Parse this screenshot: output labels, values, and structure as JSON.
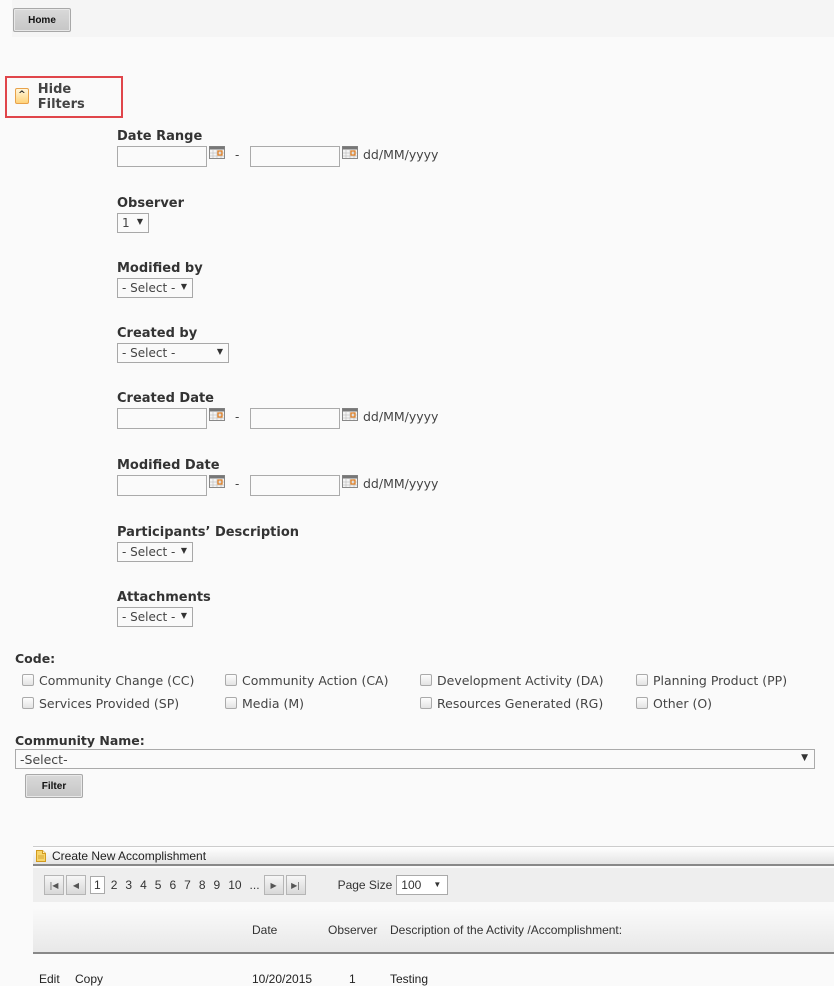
{
  "header": {
    "home_label": "Home"
  },
  "filters_toggle": {
    "label": "Hide Filters",
    "icon": "^"
  },
  "filters": {
    "date_range": {
      "label": "Date Range",
      "from": "",
      "to": "",
      "separator": "-",
      "format": "dd/MM/yyyy"
    },
    "observer": {
      "label": "Observer",
      "value": "1"
    },
    "modified_by": {
      "label": "Modified by",
      "value": "- Select -"
    },
    "created_by": {
      "label": "Created by",
      "value": "- Select -"
    },
    "created_date": {
      "label": "Created Date",
      "from": "",
      "to": "",
      "separator": "-",
      "format": "dd/MM/yyyy"
    },
    "modified_date": {
      "label": "Modified Date",
      "from": "",
      "to": "",
      "separator": "-",
      "format": "dd/MM/yyyy"
    },
    "participants_description": {
      "label": "Participants’ Description",
      "value": "- Select -"
    },
    "attachments": {
      "label": "Attachments",
      "value": "- Select -"
    }
  },
  "code": {
    "label": "Code:",
    "options": [
      {
        "label": "Community Change (CC)",
        "checked": false
      },
      {
        "label": "Community Action (CA)",
        "checked": false
      },
      {
        "label": "Development Activity (DA)",
        "checked": false
      },
      {
        "label": "Planning Product (PP)",
        "checked": false
      },
      {
        "label": "Services Provided (SP)",
        "checked": false
      },
      {
        "label": "Media (M)",
        "checked": false
      },
      {
        "label": "Resources Generated (RG)",
        "checked": false
      },
      {
        "label": "Other (O)",
        "checked": false
      }
    ]
  },
  "community": {
    "label": "Community Name:",
    "value": "-Select-"
  },
  "filter_button": {
    "label": "Filter"
  },
  "grid": {
    "create_label": "Create New Accomplishment",
    "pager": {
      "pages": [
        "1",
        "2",
        "3",
        "4",
        "5",
        "6",
        "7",
        "8",
        "9",
        "10",
        "..."
      ],
      "current": "1",
      "page_size_label": "Page Size",
      "page_size": "100"
    },
    "columns": [
      "Date",
      "Observer",
      "Description of the Activity /Accomplishment:"
    ],
    "rows": [
      {
        "edit": "Edit",
        "copy": "Copy",
        "date": "10/20/2015",
        "observer": "1",
        "description": "Testing"
      }
    ]
  }
}
